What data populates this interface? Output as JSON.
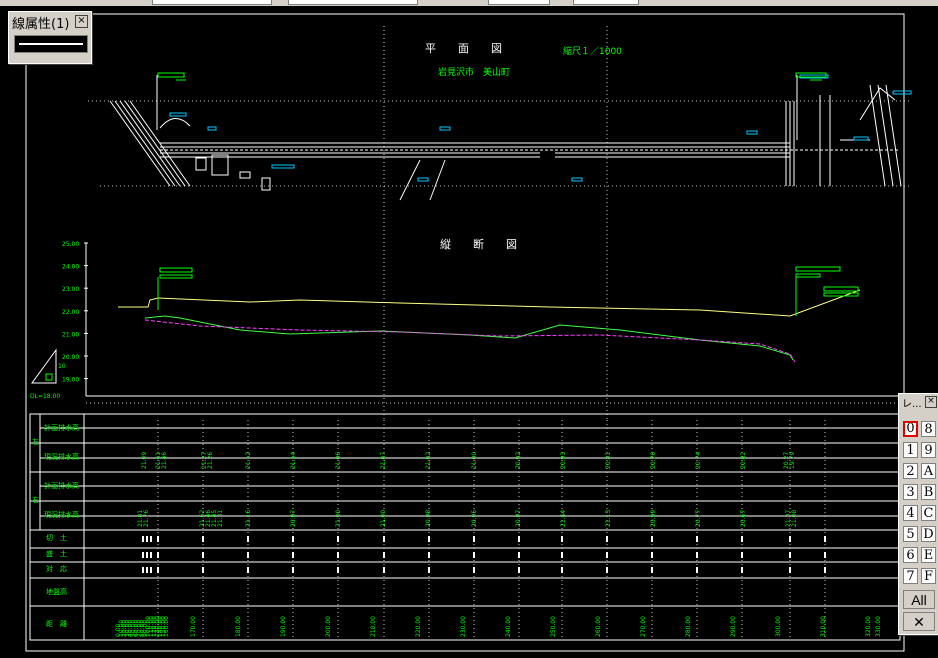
{
  "plan_view": {
    "title": "平　　面　　図",
    "scale": "縮尺１／1000",
    "location": "岩見沢市　美山町"
  },
  "profile_view": {
    "title": "縦　　断　　図",
    "axis_labels": [
      "25.00",
      "24.00",
      "23.00",
      "22.00",
      "21.00",
      "20.00",
      "19.00"
    ],
    "datum": "DL=18.00",
    "box_label": "10"
  },
  "table": {
    "row_labels": [
      "計画排水高",
      "現況排水高",
      "計画排水高",
      "現況排水高",
      "切　土",
      "盛　土",
      "対　応",
      "地盤高",
      "距　離"
    ],
    "side_labels": [
      "左",
      "右"
    ],
    "left_current": [
      "21.09",
      "21.61",
      "21.46",
      "21.27",
      "21.26",
      "21.12",
      "21.14",
      "21.06",
      "21.07",
      "21.02",
      "21.00",
      "20.92",
      "20.93",
      "20.81",
      "20.76",
      "20.74",
      "20.62",
      "20.27",
      "19.79"
    ],
    "right_current": [
      "21.81",
      "21.76",
      "21.62",
      "21.46",
      "21.45",
      "21.31",
      "21.16",
      "20.97",
      "21.00",
      "21.00",
      "20.98",
      "20.95",
      "20.97",
      "21.44",
      "21.13",
      "20.99",
      "20.77",
      "20.67",
      "21.37",
      "21.08"
    ],
    "distances": [
      "0.00",
      "10.00",
      "20.00",
      "30.00",
      "40.00",
      "50.00",
      "60.00",
      "70.00",
      "80.00",
      "90.00",
      "100.00",
      "110.00",
      "120.00",
      "130.00",
      "140.00",
      "150.00",
      "160.00",
      "170.00",
      "180.00",
      "190.00",
      "200.00",
      "210.00",
      "220.00",
      "230.00",
      "240.00",
      "250.00",
      "260.00",
      "270.00",
      "280.00",
      "290.00",
      "300.00",
      "310.00",
      "320.00",
      "330.00"
    ]
  },
  "line_attr_palette": {
    "title": "線属性(1)",
    "close": "×"
  },
  "layer_palette": {
    "title": "レ...",
    "close": "×",
    "buttons": [
      "0",
      "8",
      "1",
      "9",
      "2",
      "A",
      "3",
      "B",
      "4",
      "C",
      "5",
      "D",
      "6",
      "E",
      "7",
      "F"
    ],
    "all_label": "All",
    "close_glyph": "✕"
  },
  "colors": {
    "background": "#000000",
    "frame": "#ffffff",
    "text_green": "#00ff00",
    "text_white": "#ffffff",
    "cyan": "#00c8ff",
    "plan_line": "#ffffff",
    "design_line": "#ffff80",
    "ground_line": "#40ff40",
    "drain_line": "#ff40ff",
    "grid_dot": "#c8c8c8",
    "active_layer": "#e00000"
  }
}
